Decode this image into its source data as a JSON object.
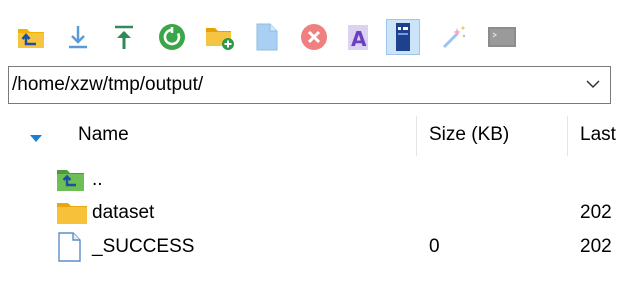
{
  "toolbar": {
    "buttons": [
      {
        "name": "parent-directory-icon",
        "color": "#e8a000"
      },
      {
        "name": "download-icon",
        "color": "#5b9bd5"
      },
      {
        "name": "upload-icon",
        "color": "#2e8b57"
      },
      {
        "name": "refresh-icon",
        "color": "#3aa64a"
      },
      {
        "name": "new-folder-icon",
        "color": "#f0b400"
      },
      {
        "name": "new-file-icon",
        "color": "#9cc8ee"
      },
      {
        "name": "delete-icon",
        "color": "#f07070"
      },
      {
        "name": "rename-icon",
        "color": "#7b5cc7"
      },
      {
        "name": "properties-icon",
        "color": "#1f4fa0",
        "active": true
      },
      {
        "name": "magic-wand-icon",
        "color": "#8ab4e8"
      },
      {
        "name": "terminal-icon",
        "color": "#8c8c8c"
      }
    ]
  },
  "path_bar": {
    "value": "/home/xzw/tmp/output/"
  },
  "columns": {
    "name": "Name",
    "size": "Size (KB)",
    "last": "Last"
  },
  "files": [
    {
      "icon": "parent-folder-icon",
      "name": "..",
      "size": "",
      "date": ""
    },
    {
      "icon": "folder-icon",
      "name": "dataset",
      "size": "",
      "date": "202"
    },
    {
      "icon": "file-icon",
      "name": "_SUCCESS",
      "size": "0",
      "date": "202"
    }
  ],
  "colors": {
    "folder": "#f5b921",
    "parent_folder": "#5fae4a",
    "selected_button_bg": "#cce4f7",
    "sort_arrow": "#1a7fd6"
  }
}
